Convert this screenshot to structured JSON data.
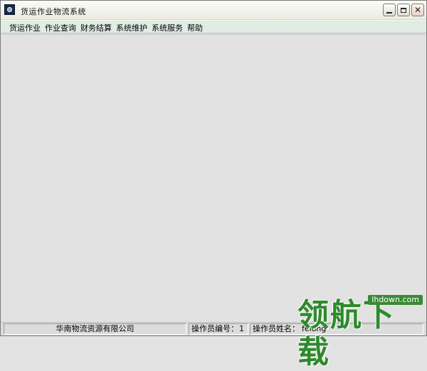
{
  "window": {
    "title": "货运作业物流系统"
  },
  "title_buttons": {
    "minimize": "minimize-icon",
    "maximize": "maximize-icon",
    "close": "close-icon"
  },
  "menu": {
    "items": [
      {
        "label": "货运作业"
      },
      {
        "label": "作业查询"
      },
      {
        "label": "财务结算"
      },
      {
        "label": "系统维护"
      },
      {
        "label": "系统服务"
      },
      {
        "label": "帮助"
      }
    ]
  },
  "status": {
    "company": "华南物流资源有限公司",
    "operator_id_label": "操作员编号：",
    "operator_id_value": "1",
    "operator_name_label": "操作员姓名：",
    "operator_name_value": "feiong"
  },
  "watermark": {
    "brand": "领航下载",
    "url": "lhdown.com"
  },
  "colors": {
    "menu_bg": "#e1ece4",
    "client_bg": "#e2e2e2",
    "watermark_green": "#2f8a2d"
  }
}
